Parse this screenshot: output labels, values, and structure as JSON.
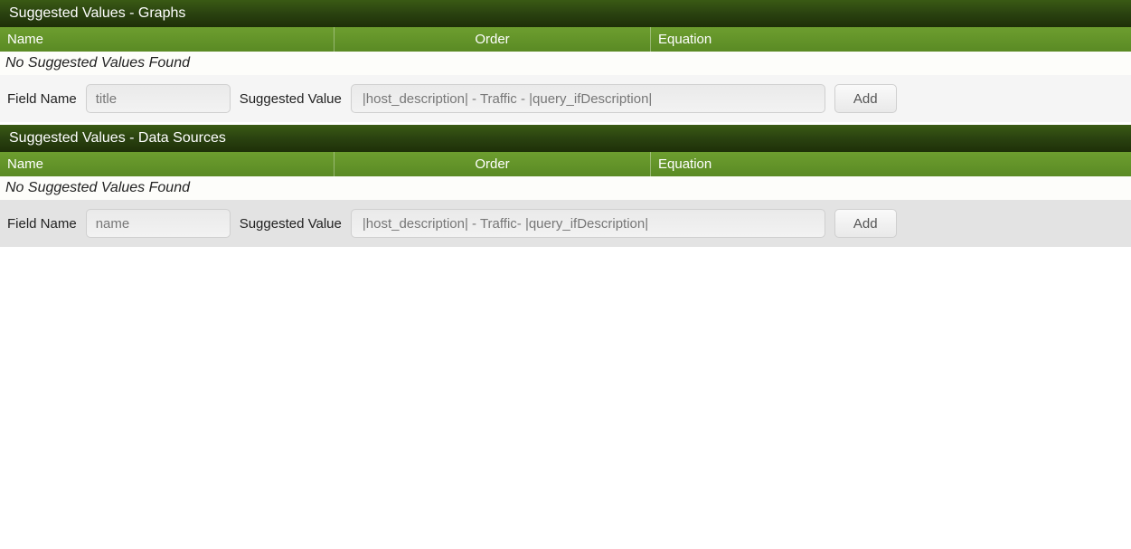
{
  "sections": {
    "graphs": {
      "title": "Suggested Values - Graphs",
      "columns": {
        "name": "Name",
        "order": "Order",
        "equation": "Equation"
      },
      "empty": "No Suggested Values Found",
      "field_name_label": "Field Name",
      "field_name_value": "title",
      "suggested_label": "Suggested Value",
      "suggested_value": "|host_description| - Traffic - |query_ifDescription|",
      "add_label": "Add"
    },
    "datasources": {
      "title": "Suggested Values - Data Sources",
      "columns": {
        "name": "Name",
        "order": "Order",
        "equation": "Equation"
      },
      "empty": "No Suggested Values Found",
      "field_name_label": "Field Name",
      "field_name_value": "name",
      "suggested_label": "Suggested Value",
      "suggested_value": "|host_description| - Traffic- |query_ifDescription|",
      "add_label": "Add"
    }
  }
}
